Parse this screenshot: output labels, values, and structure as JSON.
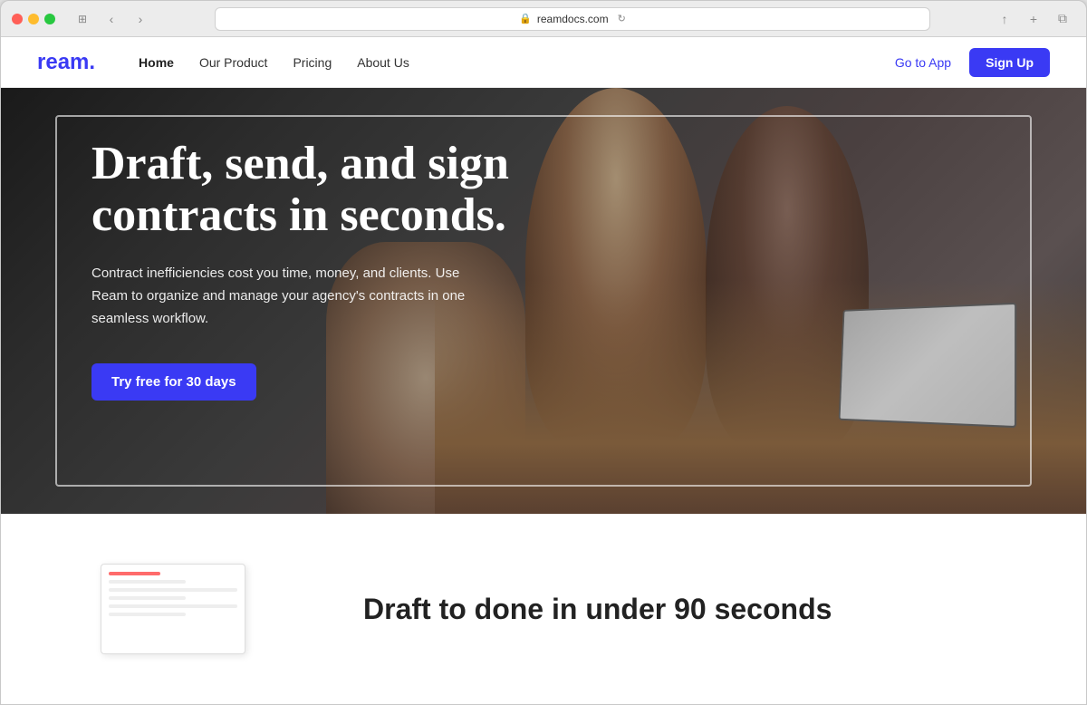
{
  "browser": {
    "url": "reamdocs.com",
    "back_label": "‹",
    "forward_label": "›",
    "share_icon": "↑",
    "new_tab_icon": "+",
    "tab_icon": "⊞"
  },
  "nav": {
    "logo": "ream.",
    "links": [
      {
        "label": "Home",
        "active": true
      },
      {
        "label": "Our Product",
        "active": false
      },
      {
        "label": "Pricing",
        "active": false
      },
      {
        "label": "About Us",
        "active": false
      }
    ],
    "go_to_app": "Go to App",
    "sign_up": "Sign Up"
  },
  "hero": {
    "title": "Draft, send, and sign contracts in seconds.",
    "subtitle": "Contract inefficiencies cost you time, money, and clients. Use Ream to organize and manage your agency's contracts in one seamless workflow.",
    "cta_label": "Try free for 30 days"
  },
  "bottom": {
    "title": "Draft to done in under 90 seconds"
  }
}
